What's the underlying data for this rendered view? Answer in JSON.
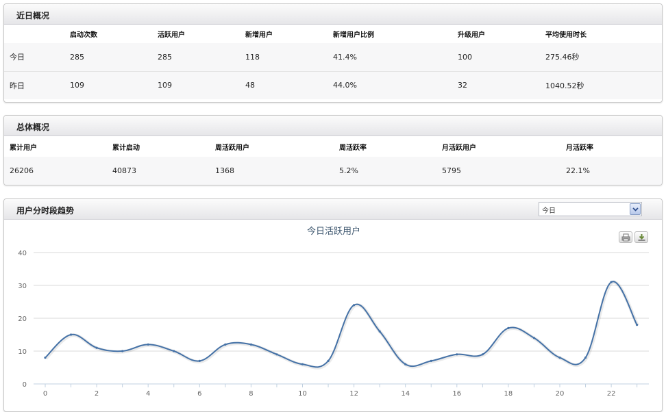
{
  "recent": {
    "title": "近日概况",
    "headers": [
      "",
      "启动次数",
      "活跃用户",
      "新增用户",
      "新增用户比例",
      "升级用户",
      "平均使用时长"
    ],
    "rows": [
      [
        "今日",
        "285",
        "285",
        "118",
        "41.4%",
        "100",
        "275.46秒"
      ],
      [
        "昨日",
        "109",
        "109",
        "48",
        "44.0%",
        "32",
        "1040.52秒"
      ]
    ]
  },
  "overall": {
    "title": "总体概况",
    "headers": [
      "累计用户",
      "累计启动",
      "周活跃用户",
      "周活跃率",
      "月活跃用户",
      "月活跃率"
    ],
    "rows": [
      [
        "26206",
        "40873",
        "1368",
        "5.2%",
        "5795",
        "22.1%"
      ]
    ]
  },
  "trend": {
    "title": "用户分时段趋势",
    "select_value": "今日",
    "print_icon": "print-icon",
    "download_icon": "download-icon"
  },
  "chart_data": {
    "type": "line",
    "title": "今日活跃用户",
    "x": [
      0,
      1,
      2,
      3,
      4,
      5,
      6,
      7,
      8,
      9,
      10,
      11,
      12,
      13,
      14,
      15,
      16,
      17,
      18,
      19,
      20,
      21,
      22,
      23
    ],
    "series": [
      {
        "values": [
          8,
          15,
          11,
          10,
          12,
          10,
          7,
          12,
          12,
          9,
          6,
          7,
          24,
          16,
          6,
          7,
          9,
          9,
          17,
          14,
          8,
          8,
          31,
          18
        ]
      }
    ],
    "xticks": [
      0,
      2,
      4,
      6,
      8,
      10,
      12,
      14,
      16,
      18,
      20,
      22
    ],
    "yticks": [
      0,
      10,
      20,
      30,
      40
    ],
    "ylim": [
      0,
      40
    ],
    "xlim": [
      0,
      23
    ],
    "grid": true,
    "line_color": "#4572a7"
  }
}
